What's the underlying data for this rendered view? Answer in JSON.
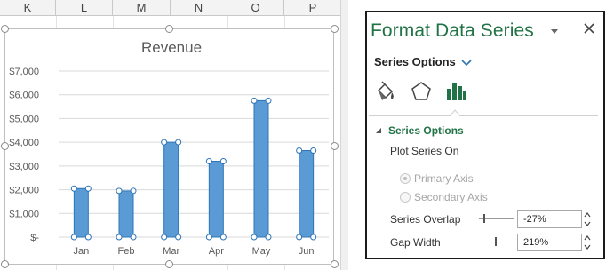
{
  "sheet": {
    "columns": [
      "K",
      "L",
      "M",
      "N",
      "O",
      "P"
    ]
  },
  "colors": {
    "bar_fill": "#5b9bd5",
    "bar_stroke": "#2e75b6",
    "accent_green": "#217346",
    "gridline": "#d9d9d9"
  },
  "chart_data": {
    "type": "bar",
    "title": "Revenue",
    "categories": [
      "Jan",
      "Feb",
      "Mar",
      "Apr",
      "May",
      "Jun"
    ],
    "values": [
      2050,
      1950,
      4000,
      3200,
      5750,
      3650
    ],
    "ylim": [
      0,
      7000
    ],
    "y_ticks": [
      {
        "value": 0,
        "label": "$-"
      },
      {
        "value": 1000,
        "label": "$1,000"
      },
      {
        "value": 2000,
        "label": "$2,000"
      },
      {
        "value": 3000,
        "label": "$3,000"
      },
      {
        "value": 4000,
        "label": "$4,000"
      },
      {
        "value": 5000,
        "label": "$5,000"
      },
      {
        "value": 6000,
        "label": "$6,000"
      },
      {
        "value": 7000,
        "label": "$7,000"
      }
    ],
    "grid": true,
    "selected_series": true
  },
  "pane": {
    "title": "Format Data Series",
    "dropdown_icon": "chevron-down-icon",
    "close_icon": "close-icon",
    "options_dropdown_label": "Series Options",
    "tabs": [
      {
        "name": "fill-line-icon",
        "active": false
      },
      {
        "name": "effects-pentagon-icon",
        "active": false
      },
      {
        "name": "series-options-bars-icon",
        "active": true
      }
    ],
    "section_label": "Series Options",
    "plot_on_label": "Plot Series On",
    "primary_axis_label": "Primary Axis",
    "secondary_axis_label": "Secondary Axis",
    "series_overlap_label": "Series Overlap",
    "series_overlap_value": "-27%",
    "gap_width_label": "Gap Width",
    "gap_width_value": "219%"
  }
}
